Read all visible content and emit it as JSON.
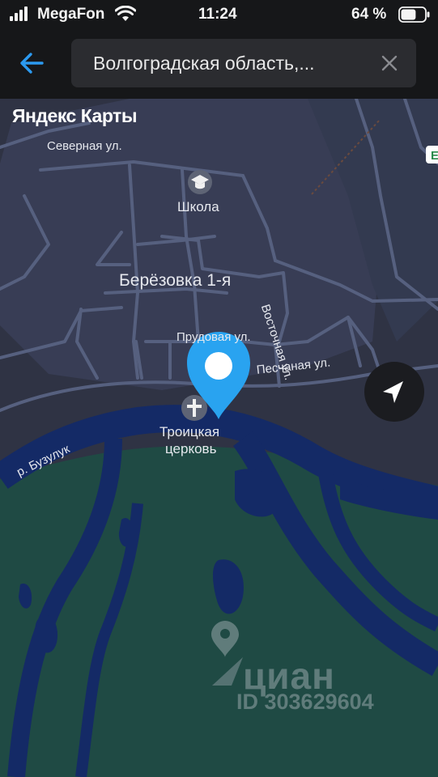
{
  "status_bar": {
    "carrier": "MegaFon",
    "time": "11:24",
    "battery_percent": "64 %",
    "battery_level": 0.64,
    "signal_bars": 4
  },
  "header": {
    "search_value": "Волгоградская область,..."
  },
  "map": {
    "brand": "Яндекс Карты",
    "labels": {
      "street_severnaya": "Северная ул.",
      "school": "Школа",
      "village": "Берёзовка 1-я",
      "street_vostochnaya": "Восточная ул.",
      "street_prud": "Прудовая ул.",
      "street_peschanaya": "Песчаная ул.",
      "church_line1": "Троицкая",
      "church_line2": "церковь",
      "river": "р. Бузулук",
      "road_badge": "Е"
    },
    "watermark": {
      "brand": "циан",
      "id": "ID 303629604"
    },
    "colors": {
      "land": "#2f3344",
      "forest": "#1f4a44",
      "water": "#142a66",
      "road": "#56607f",
      "pin": "#29a3f0"
    }
  }
}
